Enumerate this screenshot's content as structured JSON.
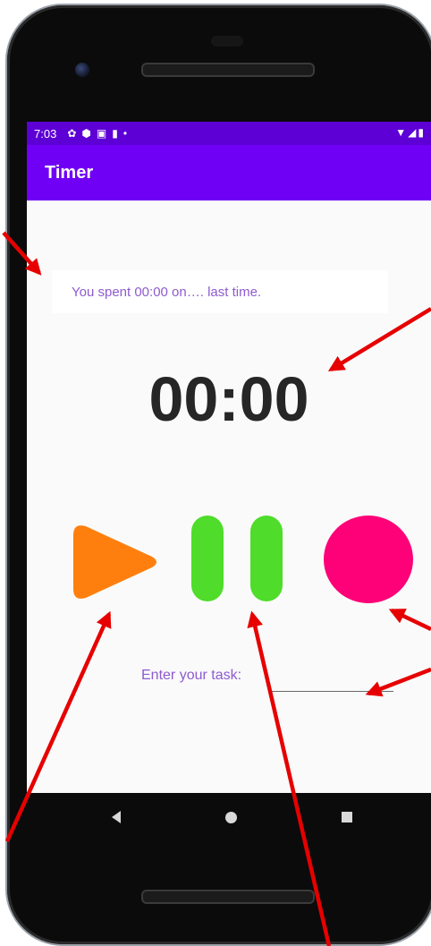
{
  "status_bar": {
    "time": "7:03",
    "left_icons": [
      "settings-icon",
      "shield-icon",
      "square-icon",
      "sim-card-icon",
      "dot-icon"
    ],
    "right_icons": [
      "wifi-icon",
      "signal-icon",
      "battery-icon"
    ]
  },
  "app_bar": {
    "title": "Timer"
  },
  "main": {
    "last_time_text": "You spent 00:00 on…. last time.",
    "timer_value": "00:00",
    "task_label": "Enter your task:",
    "task_input_value": "",
    "task_input_placeholder": ""
  },
  "controls": {
    "play_icon": "play-icon",
    "pause_icon": "pause-icon",
    "stop_icon": "stop-circle-icon"
  },
  "nav_bar": {
    "icons": [
      "back-icon",
      "home-icon",
      "recents-icon"
    ]
  },
  "colors": {
    "status_bar": "#5d00d6",
    "app_bar": "#7000f5",
    "purple_text": "#8e5bd0",
    "timer_text": "#262626",
    "play": "#ff7f0e",
    "pause": "#4fdc2a",
    "stop": "#fe0077",
    "annotation_arrow": "#e60000"
  }
}
